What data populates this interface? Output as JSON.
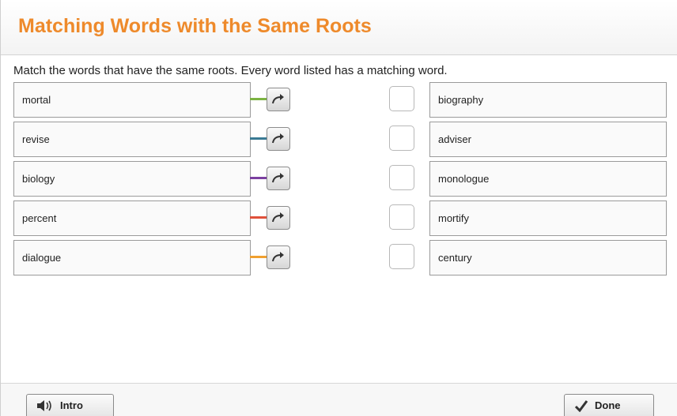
{
  "header": {
    "title": "Matching Words with the Same Roots"
  },
  "instruction": "Match the words that have the same roots. Every word listed has a matching word.",
  "left_words": [
    {
      "label": "mortal",
      "color": "#7cb342"
    },
    {
      "label": "revise",
      "color": "#3a7a94"
    },
    {
      "label": "biology",
      "color": "#7b3fa0"
    },
    {
      "label": "percent",
      "color": "#e0503a"
    },
    {
      "label": "dialogue",
      "color": "#f0a030"
    }
  ],
  "right_words": [
    {
      "label": "biography"
    },
    {
      "label": "adviser"
    },
    {
      "label": "monologue"
    },
    {
      "label": "mortify"
    },
    {
      "label": "century"
    }
  ],
  "footer": {
    "intro_label": "Intro",
    "done_label": "Done",
    "intro_icon": "speaker-icon",
    "done_icon": "checkmark-icon"
  },
  "icons": {
    "arrow": "curved-arrow-icon"
  }
}
